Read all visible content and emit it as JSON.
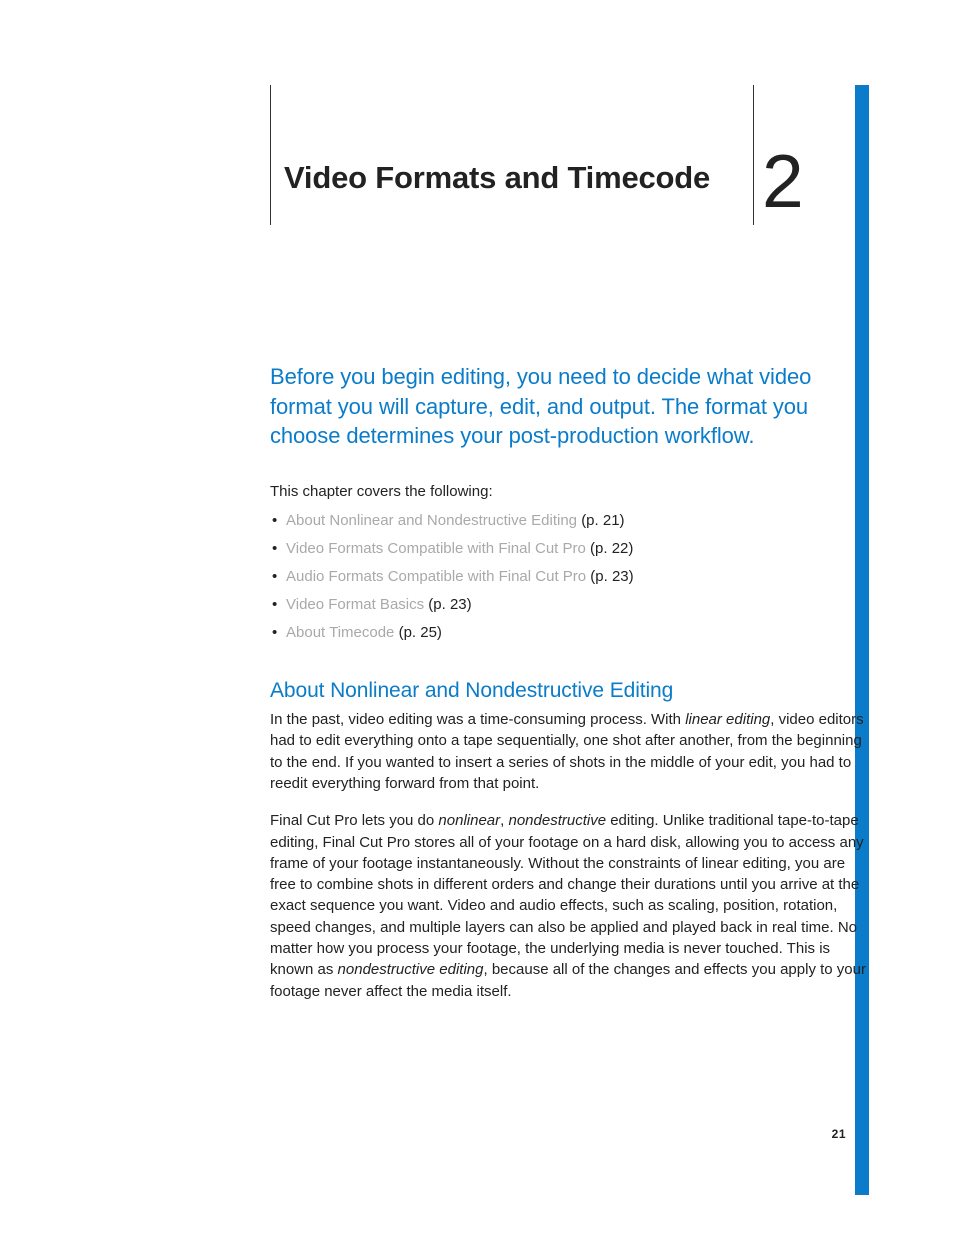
{
  "chapter": {
    "number": "2",
    "title": "Video Formats and Timecode"
  },
  "lead": "Before you begin editing, you need to decide what video format you will capture, edit, and output. The format you choose determines your post-production workflow.",
  "covers_label": "This chapter covers the following:",
  "toc": [
    {
      "text": "About Nonlinear and Nondestructive Editing",
      "page": "(p. 21)"
    },
    {
      "text": "Video Formats Compatible with Final Cut Pro",
      "page": "(p. 22)"
    },
    {
      "text": "Audio Formats Compatible with Final Cut Pro",
      "page": "(p. 23)"
    },
    {
      "text": "Video Format Basics",
      "page": "(p. 23)"
    },
    {
      "text": "About Timecode",
      "page": "(p. 25)"
    }
  ],
  "section": {
    "heading": "About Nonlinear and Nondestructive Editing",
    "para1_a": "In the past, video editing was a time-consuming process. With ",
    "para1_em1": "linear editing",
    "para1_b": ", video editors had to edit everything onto a tape sequentially, one shot after another, from the beginning to the end. If you wanted to insert a series of shots in the middle of your edit, you had to reedit everything forward from that point.",
    "para2_a": "Final Cut Pro lets you do ",
    "para2_em1": "nonlinear",
    "para2_b": ", ",
    "para2_em2": "nondestructive",
    "para2_c": " editing. Unlike traditional tape-to-tape editing, Final Cut Pro stores all of your footage on a hard disk, allowing you to access any frame of your footage instantaneously. Without the constraints of linear editing, you are free to combine shots in different orders and change their durations until you arrive at the exact sequence you want. Video and audio effects, such as scaling, position, rotation, speed changes, and multiple layers can also be applied and played back in real time. No matter how you process your footage, the underlying media is never touched. This is known as ",
    "para2_em3": "nondestructive editing",
    "para2_d": ", because all of the changes and effects you apply to your footage never affect the media itself."
  },
  "page_number": "21"
}
